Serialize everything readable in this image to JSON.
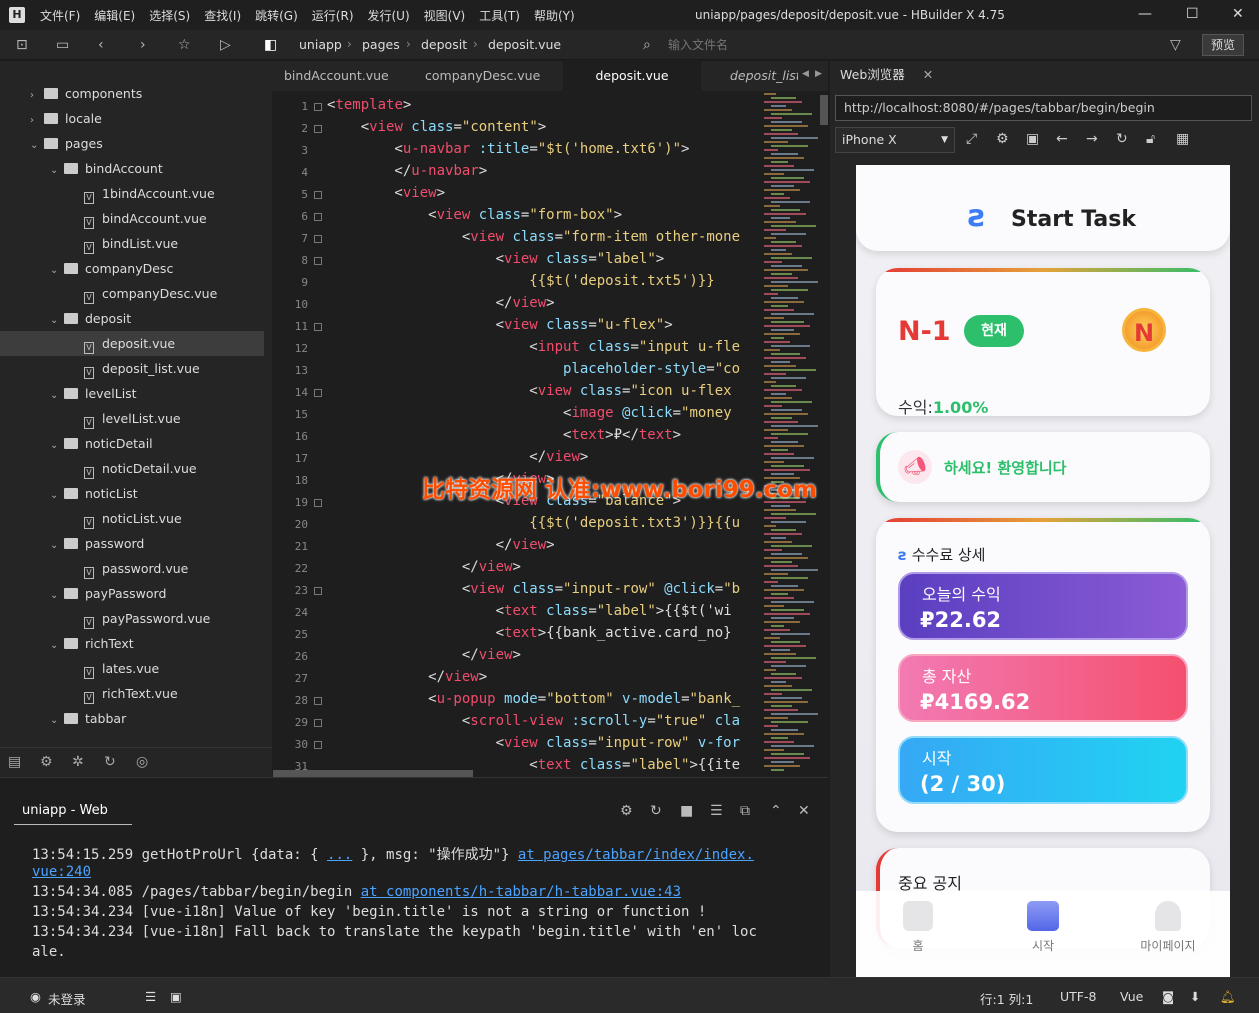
{
  "menu": [
    "文件(F)",
    "编辑(E)",
    "选择(S)",
    "查找(I)",
    "跳转(G)",
    "运行(R)",
    "发行(U)",
    "视图(V)",
    "工具(T)",
    "帮助(Y)"
  ],
  "window_title": "uniapp/pages/deposit/deposit.vue - HBuilder X 4.75",
  "breadcrumb": [
    "uniapp",
    "pages",
    "deposit",
    "deposit.vue"
  ],
  "file_search_placeholder": "输入文件名",
  "preview_label": "预览",
  "tree": [
    {
      "label": "components",
      "type": "folder",
      "depth": 0,
      "open": false
    },
    {
      "label": "locale",
      "type": "folder",
      "depth": 0,
      "open": false
    },
    {
      "label": "pages",
      "type": "folder",
      "depth": 0,
      "open": true
    },
    {
      "label": "bindAccount",
      "type": "folder",
      "depth": 1,
      "open": true
    },
    {
      "label": "1bindAccount.vue",
      "type": "file",
      "depth": 2
    },
    {
      "label": "bindAccount.vue",
      "type": "file",
      "depth": 2
    },
    {
      "label": "bindList.vue",
      "type": "file",
      "depth": 2
    },
    {
      "label": "companyDesc",
      "type": "folder",
      "depth": 1,
      "open": true
    },
    {
      "label": "companyDesc.vue",
      "type": "file",
      "depth": 2
    },
    {
      "label": "deposit",
      "type": "folder",
      "depth": 1,
      "open": true
    },
    {
      "label": "deposit.vue",
      "type": "file",
      "depth": 2,
      "selected": true
    },
    {
      "label": "deposit_list.vue",
      "type": "file",
      "depth": 2
    },
    {
      "label": "levelList",
      "type": "folder",
      "depth": 1,
      "open": true
    },
    {
      "label": "levelList.vue",
      "type": "file",
      "depth": 2
    },
    {
      "label": "noticDetail",
      "type": "folder",
      "depth": 1,
      "open": true
    },
    {
      "label": "noticDetail.vue",
      "type": "file",
      "depth": 2
    },
    {
      "label": "noticList",
      "type": "folder",
      "depth": 1,
      "open": true
    },
    {
      "label": "noticList.vue",
      "type": "file",
      "depth": 2
    },
    {
      "label": "password",
      "type": "folder",
      "depth": 1,
      "open": true
    },
    {
      "label": "password.vue",
      "type": "file",
      "depth": 2
    },
    {
      "label": "payPassword",
      "type": "folder",
      "depth": 1,
      "open": true
    },
    {
      "label": "payPassword.vue",
      "type": "file",
      "depth": 2
    },
    {
      "label": "richText",
      "type": "folder",
      "depth": 1,
      "open": true
    },
    {
      "label": "lates.vue",
      "type": "file",
      "depth": 2
    },
    {
      "label": "richText.vue",
      "type": "file",
      "depth": 2
    },
    {
      "label": "tabbar",
      "type": "folder",
      "depth": 1,
      "open": true
    }
  ],
  "tabs": [
    "bindAccount.vue",
    "companyDesc.vue",
    "deposit.vue",
    "deposit_list"
  ],
  "code_lines": [
    [
      [
        0,
        "<"
      ],
      [
        1,
        "template"
      ],
      [
        0,
        ">"
      ]
    ],
    [
      [
        0,
        "    <"
      ],
      [
        1,
        "view"
      ],
      [
        2,
        " class"
      ],
      [
        0,
        "="
      ],
      [
        3,
        "\"content\""
      ],
      [
        0,
        ">"
      ]
    ],
    [
      [
        0,
        "        <"
      ],
      [
        1,
        "u-navbar"
      ],
      [
        2,
        " :title"
      ],
      [
        0,
        "="
      ],
      [
        3,
        "\"$t('home.txt6')\""
      ],
      [
        0,
        ">"
      ]
    ],
    [
      [
        0,
        "        </"
      ],
      [
        1,
        "u-navbar"
      ],
      [
        0,
        ">"
      ]
    ],
    [
      [
        0,
        "        <"
      ],
      [
        1,
        "view"
      ],
      [
        0,
        ">"
      ]
    ],
    [
      [
        0,
        "            <"
      ],
      [
        1,
        "view"
      ],
      [
        2,
        " class"
      ],
      [
        0,
        "="
      ],
      [
        3,
        "\"form-box\""
      ],
      [
        0,
        ">"
      ]
    ],
    [
      [
        0,
        "                <"
      ],
      [
        1,
        "view"
      ],
      [
        2,
        " class"
      ],
      [
        0,
        "="
      ],
      [
        3,
        "\"form-item other-mone"
      ]
    ],
    [
      [
        0,
        "                    <"
      ],
      [
        1,
        "view"
      ],
      [
        2,
        " class"
      ],
      [
        0,
        "="
      ],
      [
        3,
        "\"label\""
      ],
      [
        0,
        ">"
      ]
    ],
    [
      [
        3,
        "                        {{$t('deposit.txt5')}}"
      ]
    ],
    [
      [
        0,
        "                    </"
      ],
      [
        1,
        "view"
      ],
      [
        0,
        ">"
      ]
    ],
    [
      [
        0,
        "                    <"
      ],
      [
        1,
        "view"
      ],
      [
        2,
        " class"
      ],
      [
        0,
        "="
      ],
      [
        3,
        "\"u-flex\""
      ],
      [
        0,
        ">"
      ]
    ],
    [
      [
        0,
        "                        <"
      ],
      [
        1,
        "input"
      ],
      [
        2,
        " class"
      ],
      [
        0,
        "="
      ],
      [
        3,
        "\"input u-fle"
      ]
    ],
    [
      [
        2,
        "                            placeholder-style"
      ],
      [
        0,
        "="
      ],
      [
        3,
        "\"co"
      ]
    ],
    [
      [
        0,
        "                        <"
      ],
      [
        1,
        "view"
      ],
      [
        2,
        " class"
      ],
      [
        0,
        "="
      ],
      [
        3,
        "\"icon u-flex"
      ]
    ],
    [
      [
        0,
        "                            <"
      ],
      [
        1,
        "image"
      ],
      [
        2,
        " @click"
      ],
      [
        0,
        "="
      ],
      [
        3,
        "\"money"
      ]
    ],
    [
      [
        0,
        "                            <"
      ],
      [
        1,
        "text"
      ],
      [
        0,
        ">₽</"
      ],
      [
        1,
        "text"
      ],
      [
        0,
        ">"
      ]
    ],
    [
      [
        0,
        "                        </"
      ],
      [
        1,
        "view"
      ],
      [
        0,
        ">"
      ]
    ],
    [
      [
        0,
        "                    </"
      ],
      [
        1,
        "view"
      ],
      [
        0,
        ">"
      ]
    ],
    [
      [
        0,
        "                    <"
      ],
      [
        1,
        "view"
      ],
      [
        2,
        " class"
      ],
      [
        0,
        "="
      ],
      [
        3,
        "\"balance\""
      ],
      [
        0,
        ">"
      ]
    ],
    [
      [
        3,
        "                        {{$t('deposit.txt3')}}{{u"
      ]
    ],
    [
      [
        0,
        "                    </"
      ],
      [
        1,
        "view"
      ],
      [
        0,
        ">"
      ]
    ],
    [
      [
        0,
        "                </"
      ],
      [
        1,
        "view"
      ],
      [
        0,
        ">"
      ]
    ],
    [
      [
        0,
        "                <"
      ],
      [
        1,
        "view"
      ],
      [
        2,
        " class"
      ],
      [
        0,
        "="
      ],
      [
        3,
        "\"input-row\""
      ],
      [
        2,
        " @click"
      ],
      [
        0,
        "="
      ],
      [
        3,
        "\"b"
      ]
    ],
    [
      [
        0,
        "                    <"
      ],
      [
        1,
        "text"
      ],
      [
        2,
        " class"
      ],
      [
        0,
        "="
      ],
      [
        3,
        "\"label\""
      ],
      [
        0,
        ">{{$t('wi"
      ]
    ],
    [
      [
        0,
        "                    <"
      ],
      [
        1,
        "text"
      ],
      [
        0,
        ">{{bank_active.card_no}"
      ]
    ],
    [
      [
        0,
        "                </"
      ],
      [
        1,
        "view"
      ],
      [
        0,
        ">"
      ]
    ],
    [
      [
        0,
        "            </"
      ],
      [
        1,
        "view"
      ],
      [
        0,
        ">"
      ]
    ],
    [
      [
        0,
        "            <"
      ],
      [
        1,
        "u-popup"
      ],
      [
        2,
        " mode"
      ],
      [
        0,
        "="
      ],
      [
        3,
        "\"bottom\""
      ],
      [
        2,
        " v-model"
      ],
      [
        0,
        "="
      ],
      [
        3,
        "\"bank_"
      ]
    ],
    [
      [
        0,
        "                <"
      ],
      [
        1,
        "scroll-view"
      ],
      [
        2,
        " :scroll-y"
      ],
      [
        0,
        "="
      ],
      [
        3,
        "\"true\""
      ],
      [
        2,
        " cla"
      ]
    ],
    [
      [
        0,
        "                    <"
      ],
      [
        1,
        "view"
      ],
      [
        2,
        " class"
      ],
      [
        0,
        "="
      ],
      [
        3,
        "\"input-row\""
      ],
      [
        2,
        " v-for"
      ]
    ],
    [
      [
        0,
        "                        <"
      ],
      [
        1,
        "text"
      ],
      [
        2,
        " class"
      ],
      [
        0,
        "="
      ],
      [
        3,
        "\"label\""
      ],
      [
        0,
        ">{{ite"
      ]
    ]
  ],
  "watermark": "比特资源网 认准:www.bori99.com",
  "browser": {
    "tab_label": "Web浏览器",
    "url": "http://localhost:8080/#/pages/tabbar/begin/begin",
    "device": "iPhone X"
  },
  "app": {
    "header_title": "Start Task",
    "level": "N-1",
    "level_badge": "현재",
    "level_icon_letter": "N",
    "income_label": "수익:",
    "income_value": "1.00%",
    "notice": "하세요! 환영합니다",
    "fee_title": "수수료 상세",
    "today_label": "오늘의 수익",
    "today_value": "₽22.62",
    "assets_label": "총 자산",
    "assets_value": "₽4169.62",
    "start_label": "시작",
    "start_value": "(2 / 30)",
    "important_notice": "중요 공지",
    "nav": [
      "홈",
      "시작",
      "마이페이지"
    ],
    "colors": {
      "level": "#e53935",
      "green": "#2dbf6c",
      "purple": "#7353c9",
      "pink": "#f5577a",
      "cyan": "#2fb5f7"
    }
  },
  "console": {
    "tab_label": "uniapp - Web",
    "lines": [
      {
        "text": "13:54:15.259 getHotProUrl {data: { ",
        "link1": "...",
        "mid": " }, msg: \"操作成功\"} ",
        "link2": "at pages/tabbar/index/index."
      },
      {
        "text": "",
        "link1": "vue:240",
        "mid": "",
        "link2": ""
      },
      {
        "text": "13:54:34.085 /pages/tabbar/begin/begin ",
        "link1": "",
        "mid": "",
        "link2": "at components/h-tabbar/h-tabbar.vue:43"
      },
      {
        "text": "13:54:34.234 [vue-i18n] Value of key 'begin.title' is not a string or function !",
        "link1": "",
        "mid": "",
        "link2": ""
      },
      {
        "text": "13:54:34.234 [vue-i18n] Fall back to translate the keypath 'begin.title' with 'en' loc",
        "link1": "",
        "mid": "",
        "link2": ""
      },
      {
        "text": "ale.",
        "link1": "",
        "mid": "",
        "link2": ""
      }
    ]
  },
  "status": {
    "login": "未登录",
    "position": "行:1  列:1",
    "encoding": "UTF-8",
    "lang": "Vue"
  }
}
